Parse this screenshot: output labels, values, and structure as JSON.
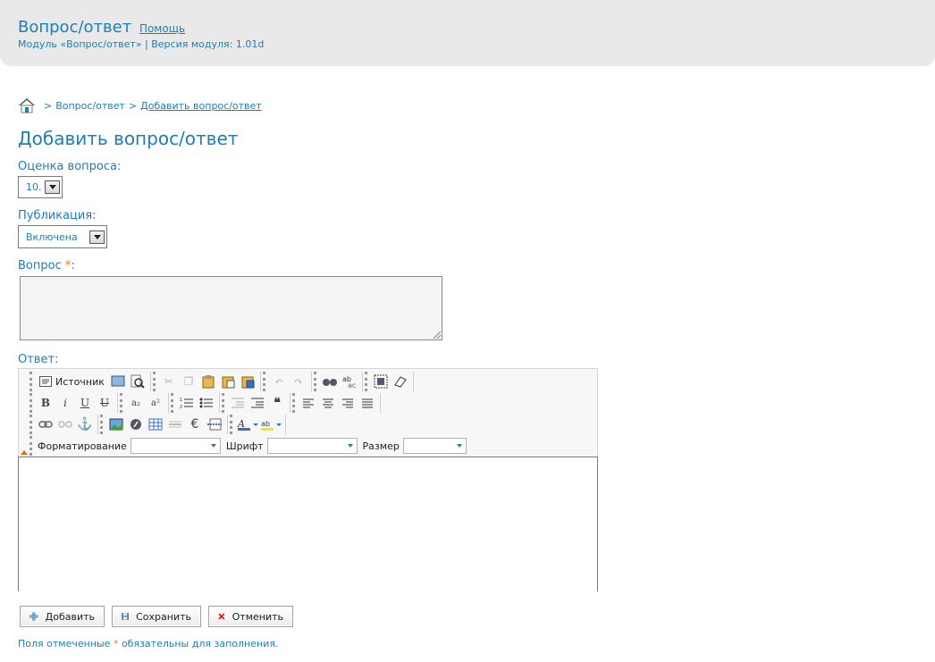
{
  "header": {
    "title": "Вопрос/ответ",
    "help": "Помощь",
    "subtitle": "Модуль «Вопрос/ответ» | Версия модуля: 1.01d"
  },
  "breadcrumb": {
    "sep": ">",
    "item1": "Вопрос/ответ",
    "item2": "Добавить вопрос/ответ"
  },
  "page_title": "Добавить вопрос/ответ",
  "rating": {
    "label": "Оценка вопроса:",
    "value": "10."
  },
  "publication": {
    "label": "Публикация:",
    "value": "Включена"
  },
  "question": {
    "label": "Вопрос",
    "required": "*",
    "colon": ":"
  },
  "answer": {
    "label": "Ответ:",
    "toolbar": {
      "source": "Источник",
      "bold": "B",
      "italic": "i",
      "underline": "U",
      "strike": "U",
      "subscript": "a₂",
      "superscript": "a²",
      "euro": "€",
      "format_label": "Форматирование",
      "font_label": "Шрифт",
      "size_label": "Размер"
    }
  },
  "buttons": {
    "add": "Добавить",
    "save": "Сохранить",
    "cancel": "Отменить"
  },
  "footnote": {
    "before": "Поля отмеченные",
    "star": "*",
    "after": "обязательны для заполнения."
  },
  "colors": {
    "accent": "#1a7fb8",
    "required": "#f07d00",
    "header_bg": "#e9e9e9"
  }
}
